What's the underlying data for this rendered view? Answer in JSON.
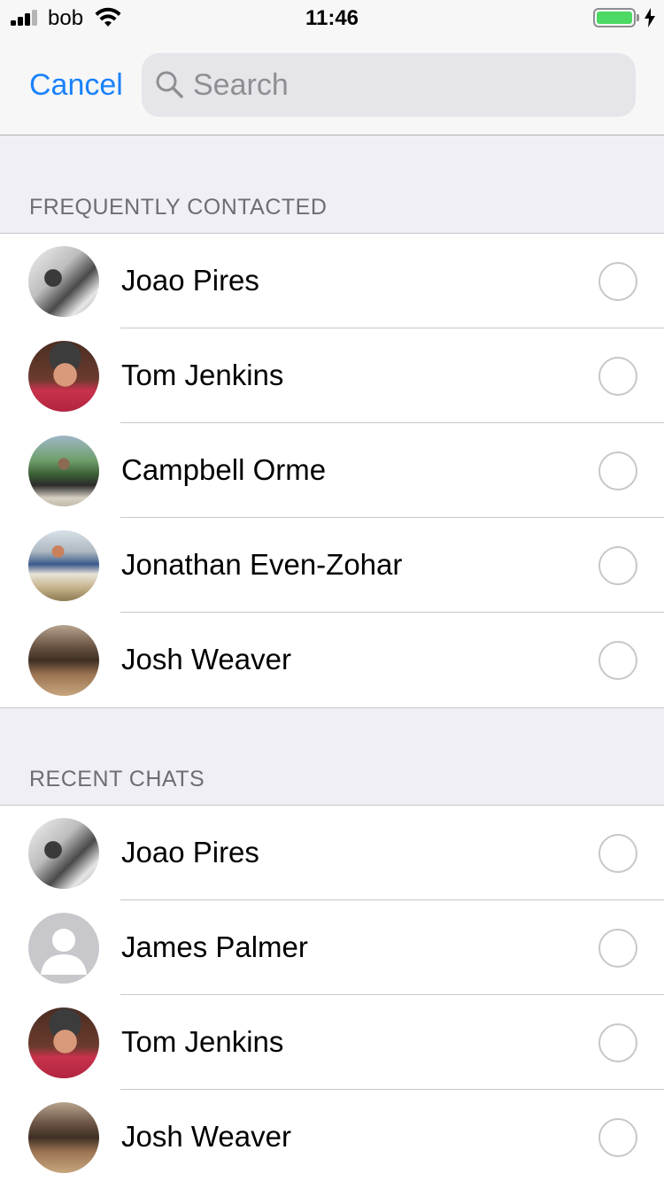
{
  "status_bar": {
    "carrier": "bob",
    "time": "11:46",
    "battery_color": "#4cd964"
  },
  "nav": {
    "cancel_label": "Cancel",
    "search_placeholder": "Search",
    "search_value": ""
  },
  "sections": [
    {
      "header": "FREQUENTLY CONTACTED",
      "contacts": [
        {
          "name": "Joao Pires",
          "avatar": "photo",
          "selected": false
        },
        {
          "name": "Tom Jenkins",
          "avatar": "photo",
          "selected": false
        },
        {
          "name": "Campbell Orme",
          "avatar": "photo",
          "selected": false
        },
        {
          "name": "Jonathan Even-Zohar",
          "avatar": "photo",
          "selected": false
        },
        {
          "name": "Josh Weaver",
          "avatar": "photo",
          "selected": false
        }
      ]
    },
    {
      "header": "RECENT CHATS",
      "contacts": [
        {
          "name": "Joao Pires",
          "avatar": "photo",
          "selected": false
        },
        {
          "name": "James Palmer",
          "avatar": "default-person-icon",
          "selected": false
        },
        {
          "name": "Tom Jenkins",
          "avatar": "photo",
          "selected": false
        },
        {
          "name": "Josh Weaver",
          "avatar": "photo",
          "selected": false
        }
      ]
    }
  ],
  "colors": {
    "accent": "#1a82fb",
    "background": "#f0eff5",
    "section_header_text": "#6d6d72"
  }
}
